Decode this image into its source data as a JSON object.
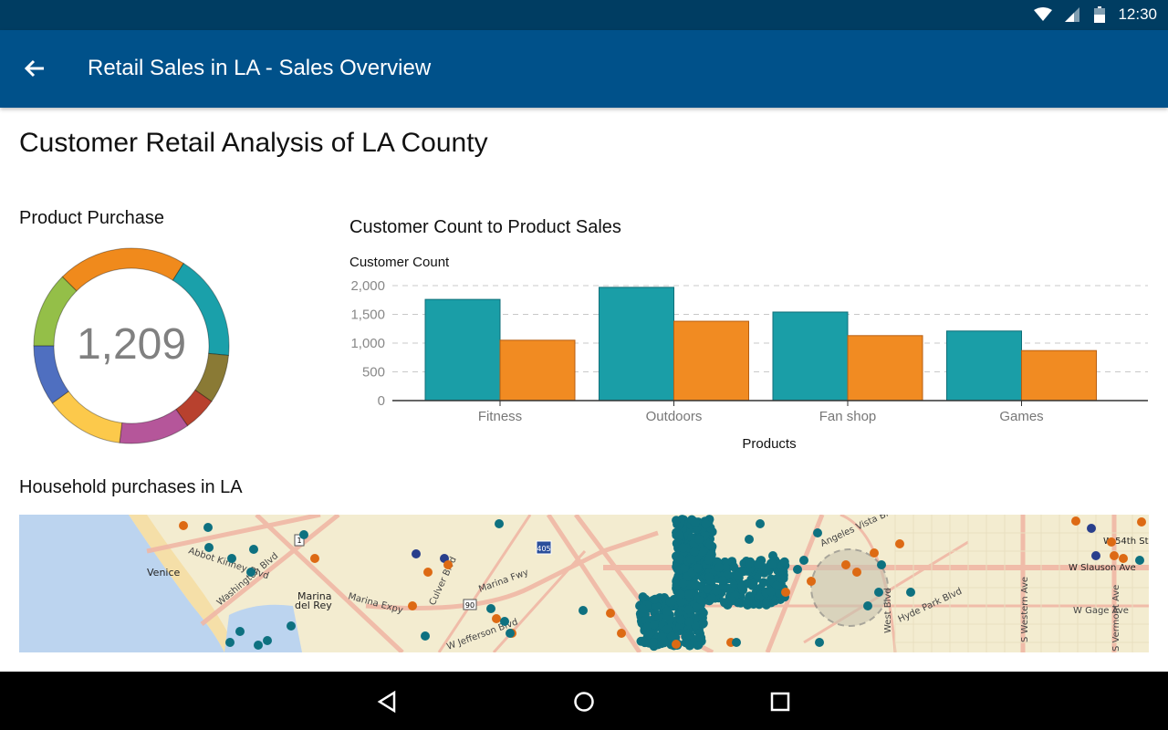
{
  "status_bar": {
    "time": "12:30",
    "icons": [
      "wifi-icon",
      "signal-icon",
      "battery-icon"
    ]
  },
  "app_bar": {
    "title": "Retail Sales in LA - Sales Overview",
    "back_icon": "arrow-back-icon"
  },
  "page": {
    "title": "Customer Retail Analysis of LA County"
  },
  "product_purchase": {
    "title": "Product Purchase",
    "total": "1,209",
    "segments": [
      {
        "color": "#f08a1c",
        "share": 21.5
      },
      {
        "color": "#1aa0aa",
        "share": 17.6
      },
      {
        "color": "#8a7a35",
        "share": 8.1
      },
      {
        "color": "#b8412e",
        "share": 5.6
      },
      {
        "color": "#b5569a",
        "share": 11.7
      },
      {
        "color": "#fcc94b",
        "share": 13.1
      },
      {
        "color": "#4f6fc0",
        "share": 10.0
      },
      {
        "color": "#94bf48",
        "share": 12.5
      }
    ]
  },
  "chart_data": {
    "type": "bar",
    "title": "Customer Count to Product Sales",
    "xlabel": "Products",
    "ylabel": "Customer Count",
    "categories": [
      "Fitness",
      "Outdoors",
      "Fan shop",
      "Games"
    ],
    "series": [
      {
        "color": "#1a9ea7",
        "values": [
          1760,
          1970,
          1540,
          1210
        ]
      },
      {
        "color": "#f18b22",
        "values": [
          1050,
          1380,
          1130,
          870
        ]
      }
    ],
    "ylim": [
      0,
      2000
    ],
    "yticks": [
      "0",
      "500",
      "1,000",
      "1,500",
      "2,000"
    ],
    "ytick_values": [
      0,
      500,
      1000,
      1500,
      2000
    ],
    "grid": true,
    "legend": "none"
  },
  "map": {
    "title": "Household purchases in LA",
    "labels": {
      "venice": "Venice",
      "marina1": "Marina",
      "marina2": "del Rey",
      "abbot": "Abbot Kinney Blvd",
      "washington": "Washington Blvd",
      "marina_expy": "Marina Expy",
      "marina_fwy": "Marina Fwy",
      "culver": "Culver Blvd",
      "jefferson": "W Jefferson Blvd",
      "slauson": "W Slauson Ave",
      "gage": "W Gage Ave",
      "hyde": "Hyde Park Blvd",
      "west_blvd": "West Blvd",
      "western": "S Western Ave",
      "vermont": "S Vermont Ave",
      "angeles": "Angeles Vista Blvd",
      "w_st": "W 54th St",
      "shield_1": "1",
      "shield_90": "90",
      "shield_405": "405"
    },
    "colors": {
      "teal": "#0e7180",
      "orange": "#dd6a14",
      "navy": "#293f8c",
      "water": "#bcd4ef",
      "land": "#f3ecd0"
    }
  },
  "nav_bar": {
    "buttons": [
      "back",
      "home",
      "recents"
    ]
  }
}
